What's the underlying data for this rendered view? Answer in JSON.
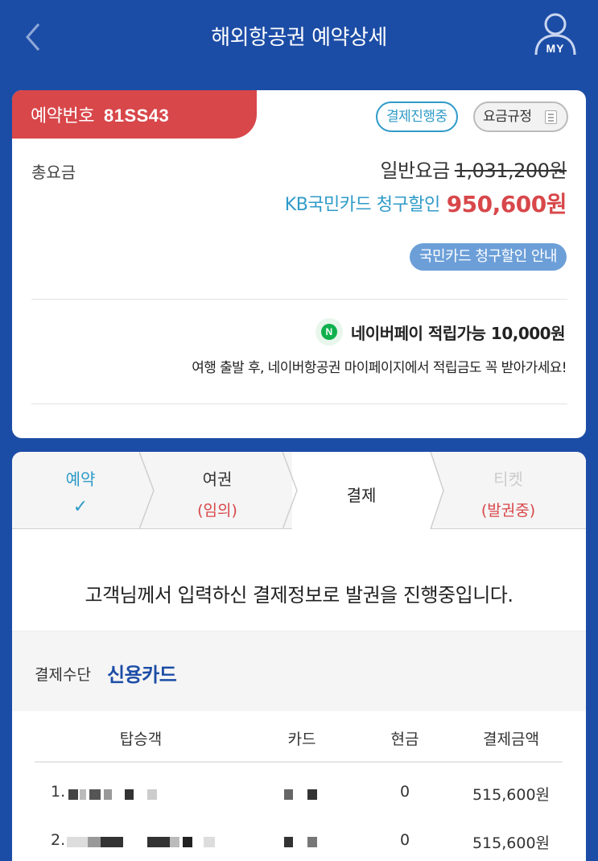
{
  "header": {
    "title": "해외항공권 예약상세",
    "my_label": "MY"
  },
  "summary": {
    "reservation_label": "예약번호",
    "reservation_number": "81SS43",
    "status_badge": "결제진행중",
    "fare_rule_button": "요금규정",
    "total_label": "총요금",
    "regular_fare_label": "일반요금",
    "regular_fare_price": "1,031,200원",
    "discount_label": "KB국민카드 청구할인",
    "discount_price": "950,600원",
    "card_guide_button": "국민카드 청구할인 안내",
    "npay_text": "네이버페이 적립가능 10,000원",
    "npay_sub": "여행 출발 후, 네이버항공권 마이페이지에서 적립금도 꼭 받아가세요!"
  },
  "steps": [
    {
      "name": "예약",
      "sub": "✓",
      "state": "done"
    },
    {
      "name": "여권",
      "sub": "(임의)",
      "state": "done"
    },
    {
      "name": "결제",
      "sub": "",
      "state": "current"
    },
    {
      "name": "티켓",
      "sub": "(발권중)",
      "state": "pending"
    }
  ],
  "notice": "고객님께서 입력하신 결제정보로 발권을 진행중입니다.",
  "payment": {
    "method_label": "결제수단",
    "method_value": "신용카드"
  },
  "table": {
    "headers": [
      "탑승객",
      "카드",
      "현금",
      "결제금액"
    ],
    "rows": [
      {
        "index": "1.",
        "card": "",
        "cash": "0",
        "amount": "515,600원"
      },
      {
        "index": "2.",
        "card": "",
        "cash": "0",
        "amount": "515,600원"
      }
    ]
  },
  "colors": {
    "brand_blue": "#1c4da6",
    "accent_red": "#d8474a",
    "accent_teal": "#2f9bc8",
    "npay_green": "#10b04d"
  }
}
